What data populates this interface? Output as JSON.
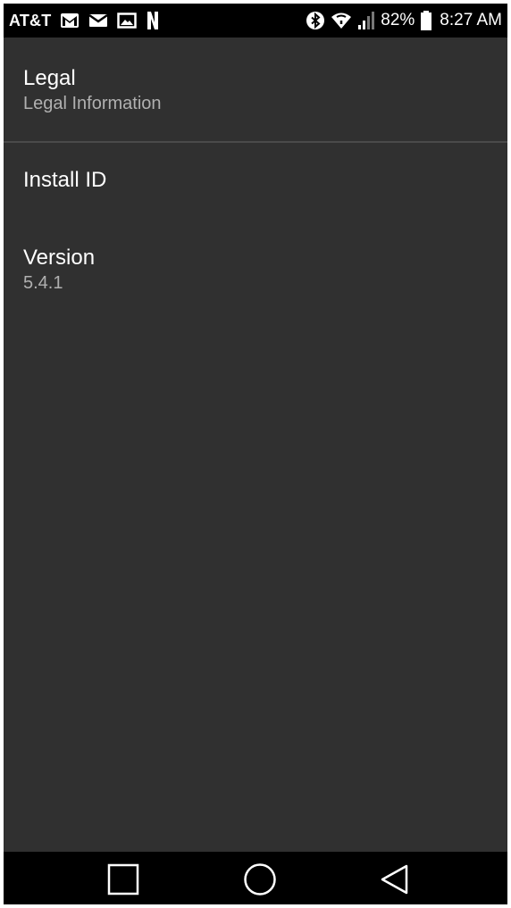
{
  "status_bar": {
    "carrier": "AT&T",
    "left_icons": [
      "gmail-icon",
      "email-icon",
      "gallery-icon",
      "netflix-icon"
    ],
    "right_icons": [
      "bluetooth-icon",
      "wifi-icon",
      "signal-icon",
      "battery-icon"
    ],
    "battery_percent": "82%",
    "time": "8:27 AM"
  },
  "settings": {
    "legal": {
      "title": "Legal",
      "summary": "Legal Information"
    },
    "install_id": {
      "title": "Install ID"
    },
    "version": {
      "title": "Version",
      "summary": "5.4.1"
    }
  },
  "nav_bar": {
    "buttons": [
      "recent-apps-icon",
      "home-icon",
      "back-icon"
    ]
  },
  "colors": {
    "background": "#303030",
    "bars": "#000000",
    "title_text": "#ffffff",
    "summary_text": "#b0b0b0",
    "divider": "#4a4a4a"
  }
}
